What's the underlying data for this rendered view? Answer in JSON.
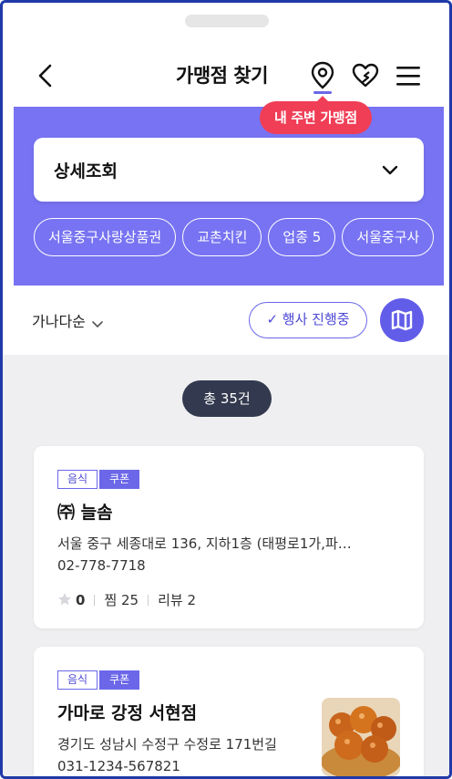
{
  "header": {
    "title": "가맹점 찾기",
    "icons": [
      "back-arrow",
      "location-pin",
      "heart",
      "menu-hamburger"
    ]
  },
  "tooltip": {
    "text": "내 주변 가맹점"
  },
  "filter": {
    "select_label": "상세조회",
    "chips": [
      "서울중구사랑상품권",
      "교촌치킨",
      "업종 5",
      "서울중구사"
    ]
  },
  "sort": {
    "label": "가나다순",
    "event_button": "✓ 행사 진행중"
  },
  "list": {
    "total": "총 35건",
    "stores": [
      {
        "tags": [
          "음식",
          "쿠폰"
        ],
        "name": "㈜ 늘솜",
        "address": "서울 중구 세종대로 136, 지하1층 (태평로1가,파…",
        "phone": "02-778-7718",
        "rating": "0",
        "likes_label": "찜 25",
        "reviews_label": "리뷰 2"
      },
      {
        "tags": [
          "음식",
          "쿠폰"
        ],
        "name": "가마로 강정 서현점",
        "address": "경기도 성남시 수정구 수정로 171번길",
        "phone": "031-1234-567821"
      }
    ]
  },
  "colors": {
    "accent": "#7773f2",
    "accent_dark": "#625de8",
    "tooltip": "#f03e56",
    "total_badge": "#333a4f",
    "list_bg": "#efeff1"
  }
}
